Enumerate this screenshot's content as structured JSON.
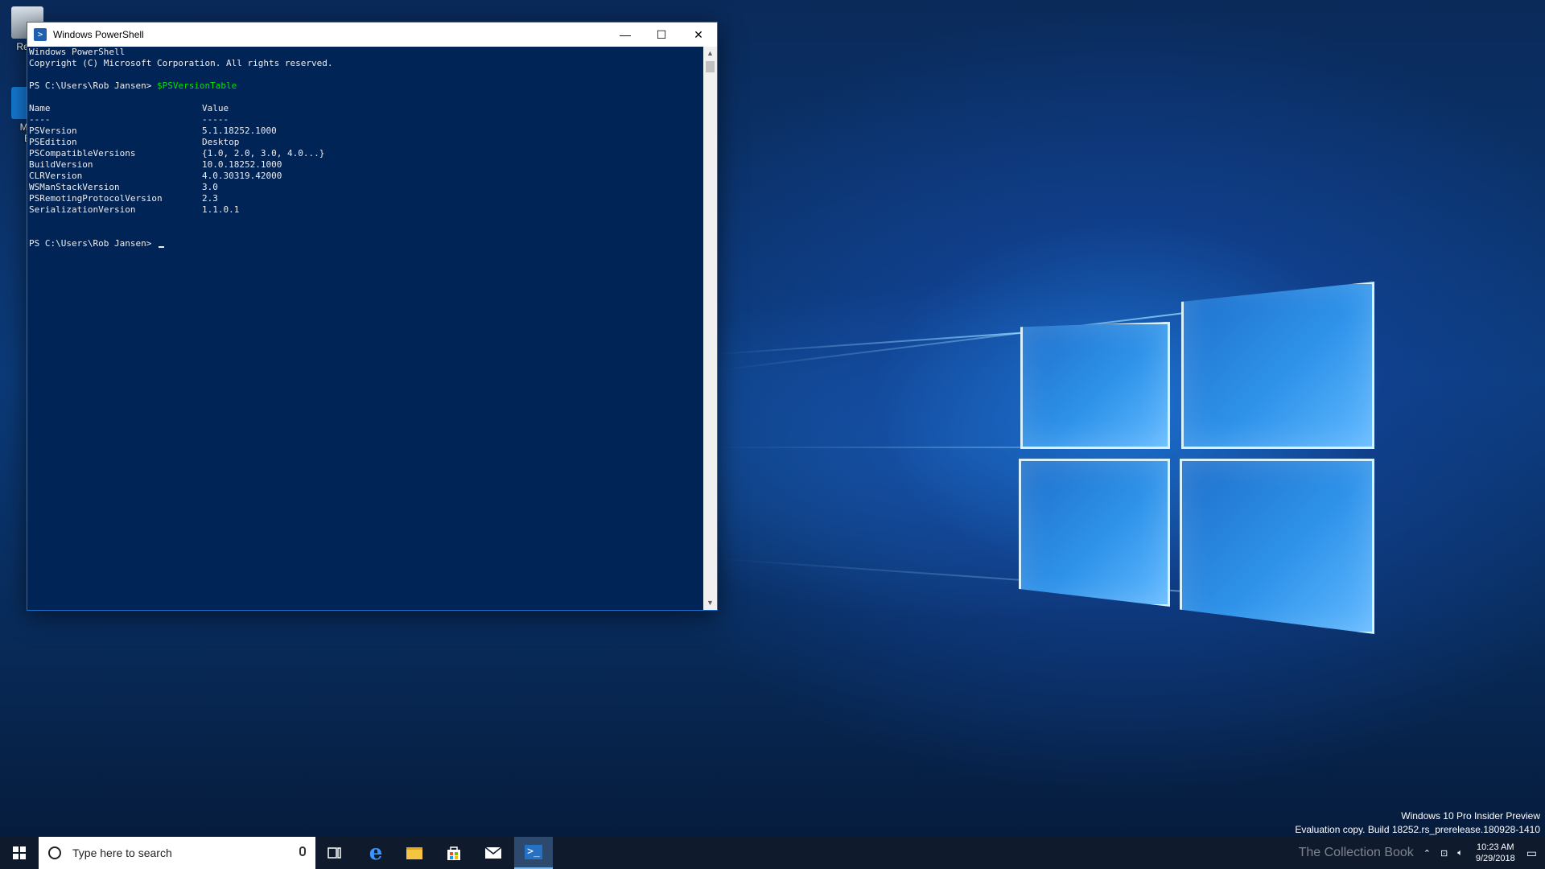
{
  "desktop": {
    "icons": [
      {
        "label": "Recy"
      },
      {
        "label": "Mic"
      },
      {
        "label": "E"
      }
    ],
    "watermark": {
      "edition": "Windows 10 Pro Insider Preview",
      "build": "Evaluation copy. Build 18252.rs_prerelease.180928-1410"
    },
    "overlay_text": "The Collection Book"
  },
  "window": {
    "title": "Windows PowerShell",
    "buttons": {
      "minimize": "—",
      "maximize": "☐",
      "close": "✕"
    }
  },
  "console": {
    "header_line1": "Windows PowerShell",
    "header_line2": "Copyright (C) Microsoft Corporation. All rights reserved.",
    "prompt": "PS C:\\Users\\Rob Jansen>",
    "command": "$PSVersionTable",
    "table_header": {
      "name": "Name",
      "value": "Value"
    },
    "table_rule": {
      "name": "----",
      "value": "-----"
    },
    "rows": [
      {
        "name": "PSVersion",
        "value": "5.1.18252.1000"
      },
      {
        "name": "PSEdition",
        "value": "Desktop"
      },
      {
        "name": "PSCompatibleVersions",
        "value": "{1.0, 2.0, 3.0, 4.0...}"
      },
      {
        "name": "BuildVersion",
        "value": "10.0.18252.1000"
      },
      {
        "name": "CLRVersion",
        "value": "4.0.30319.42000"
      },
      {
        "name": "WSManStackVersion",
        "value": "3.0"
      },
      {
        "name": "PSRemotingProtocolVersion",
        "value": "2.3"
      },
      {
        "name": "SerializationVersion",
        "value": "1.1.0.1"
      }
    ],
    "final_prompt": "PS C:\\Users\\Rob Jansen>"
  },
  "taskbar": {
    "search_placeholder": "Type here to search",
    "clock_time": "10:23 AM",
    "clock_date": "9/29/2018"
  },
  "colors": {
    "console_bg": "#012456",
    "console_fg": "#eeedf0",
    "command_green": "#00e200",
    "taskbar_bg": "#0f1b2c"
  }
}
